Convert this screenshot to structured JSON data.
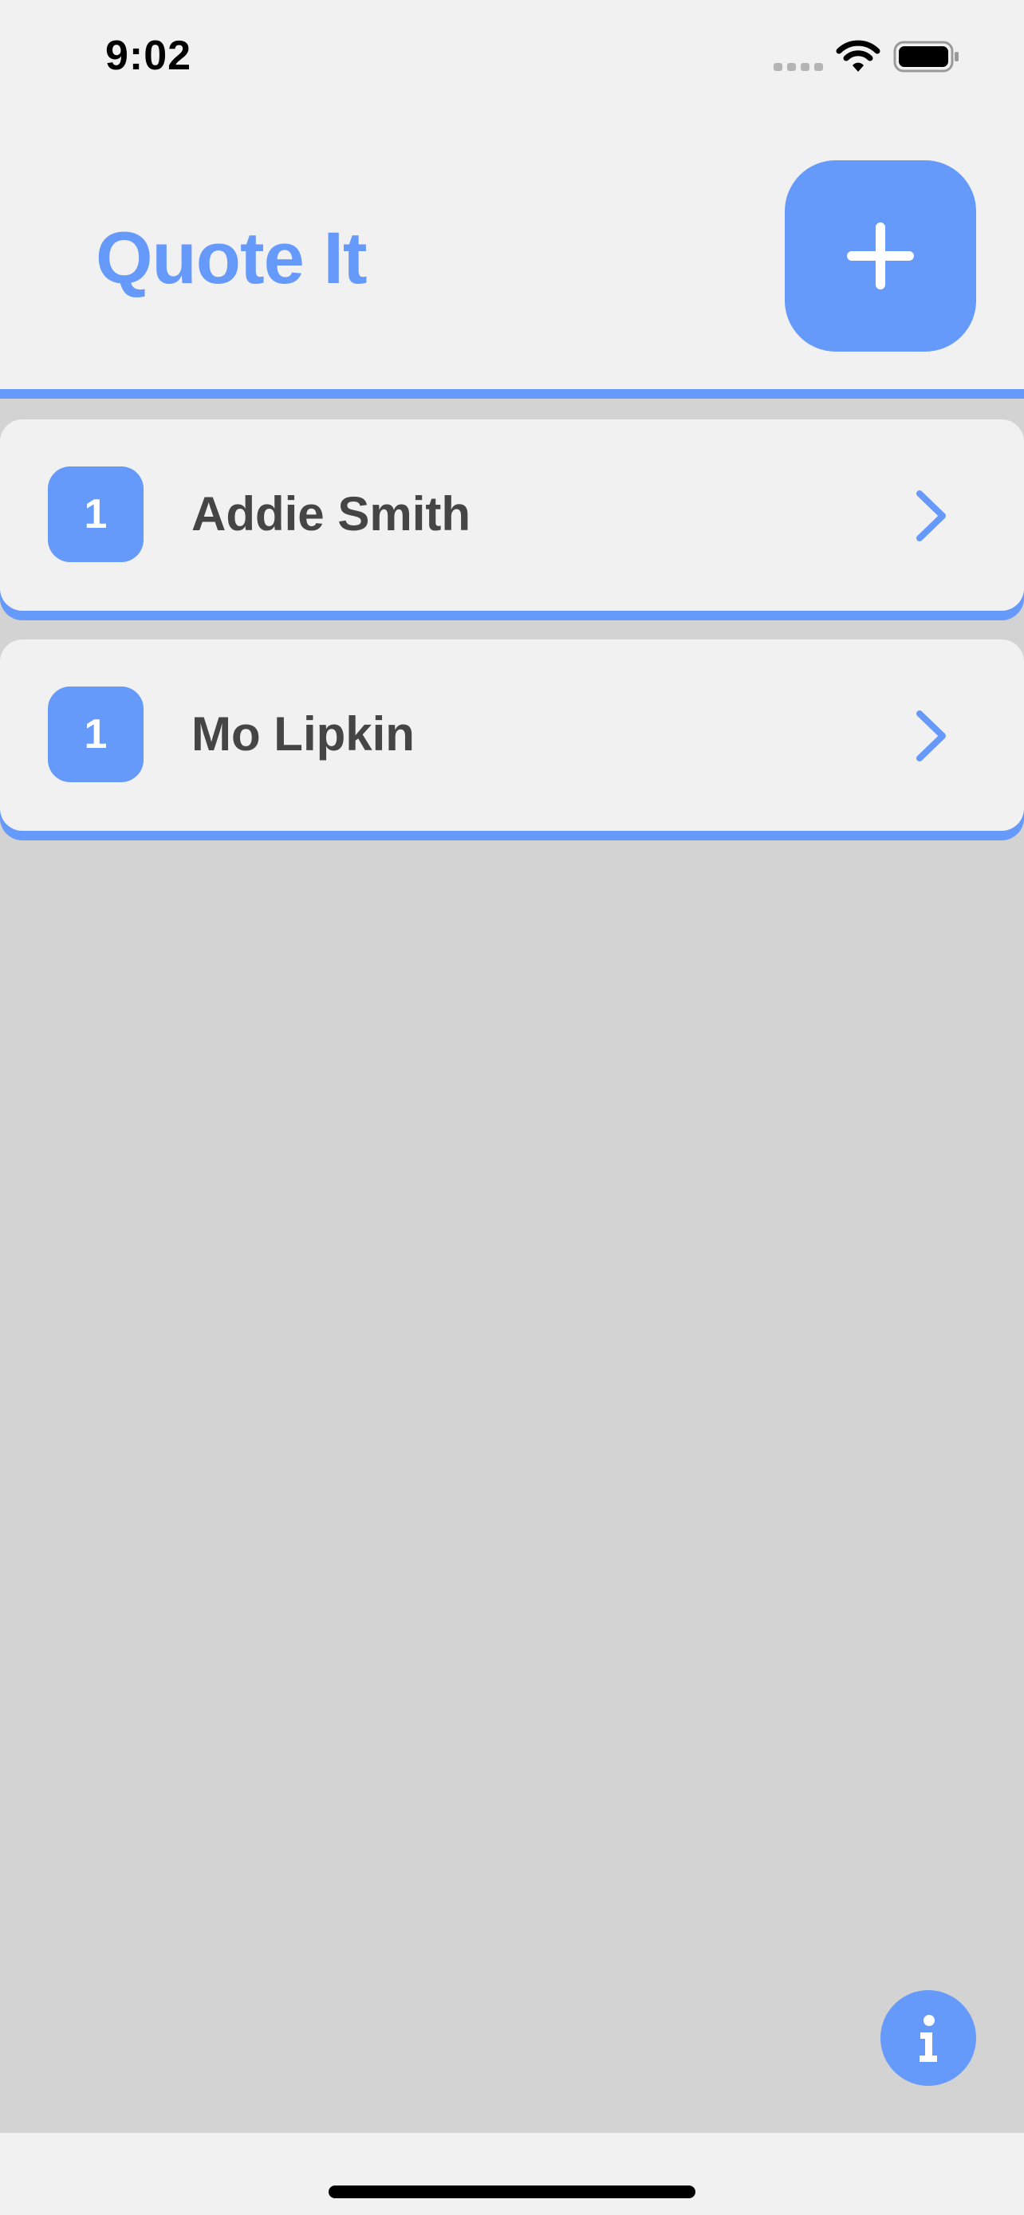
{
  "status_bar": {
    "time": "9:02",
    "icons": [
      "signal-dots-icon",
      "wifi-icon",
      "battery-icon"
    ]
  },
  "header": {
    "title": "Quote It",
    "add_button_icon": "plus-icon"
  },
  "list": {
    "items": [
      {
        "badge": "1",
        "name": "Addie Smith",
        "icon": "chevron-right-icon"
      },
      {
        "badge": "1",
        "name": "Mo Lipkin",
        "icon": "chevron-right-icon"
      }
    ]
  },
  "info_button": {
    "icon": "info-icon"
  },
  "colors": {
    "accent": "#6599fa",
    "background": "#f1f1f1",
    "list_background": "#d3d3d3",
    "text": "#454545"
  }
}
